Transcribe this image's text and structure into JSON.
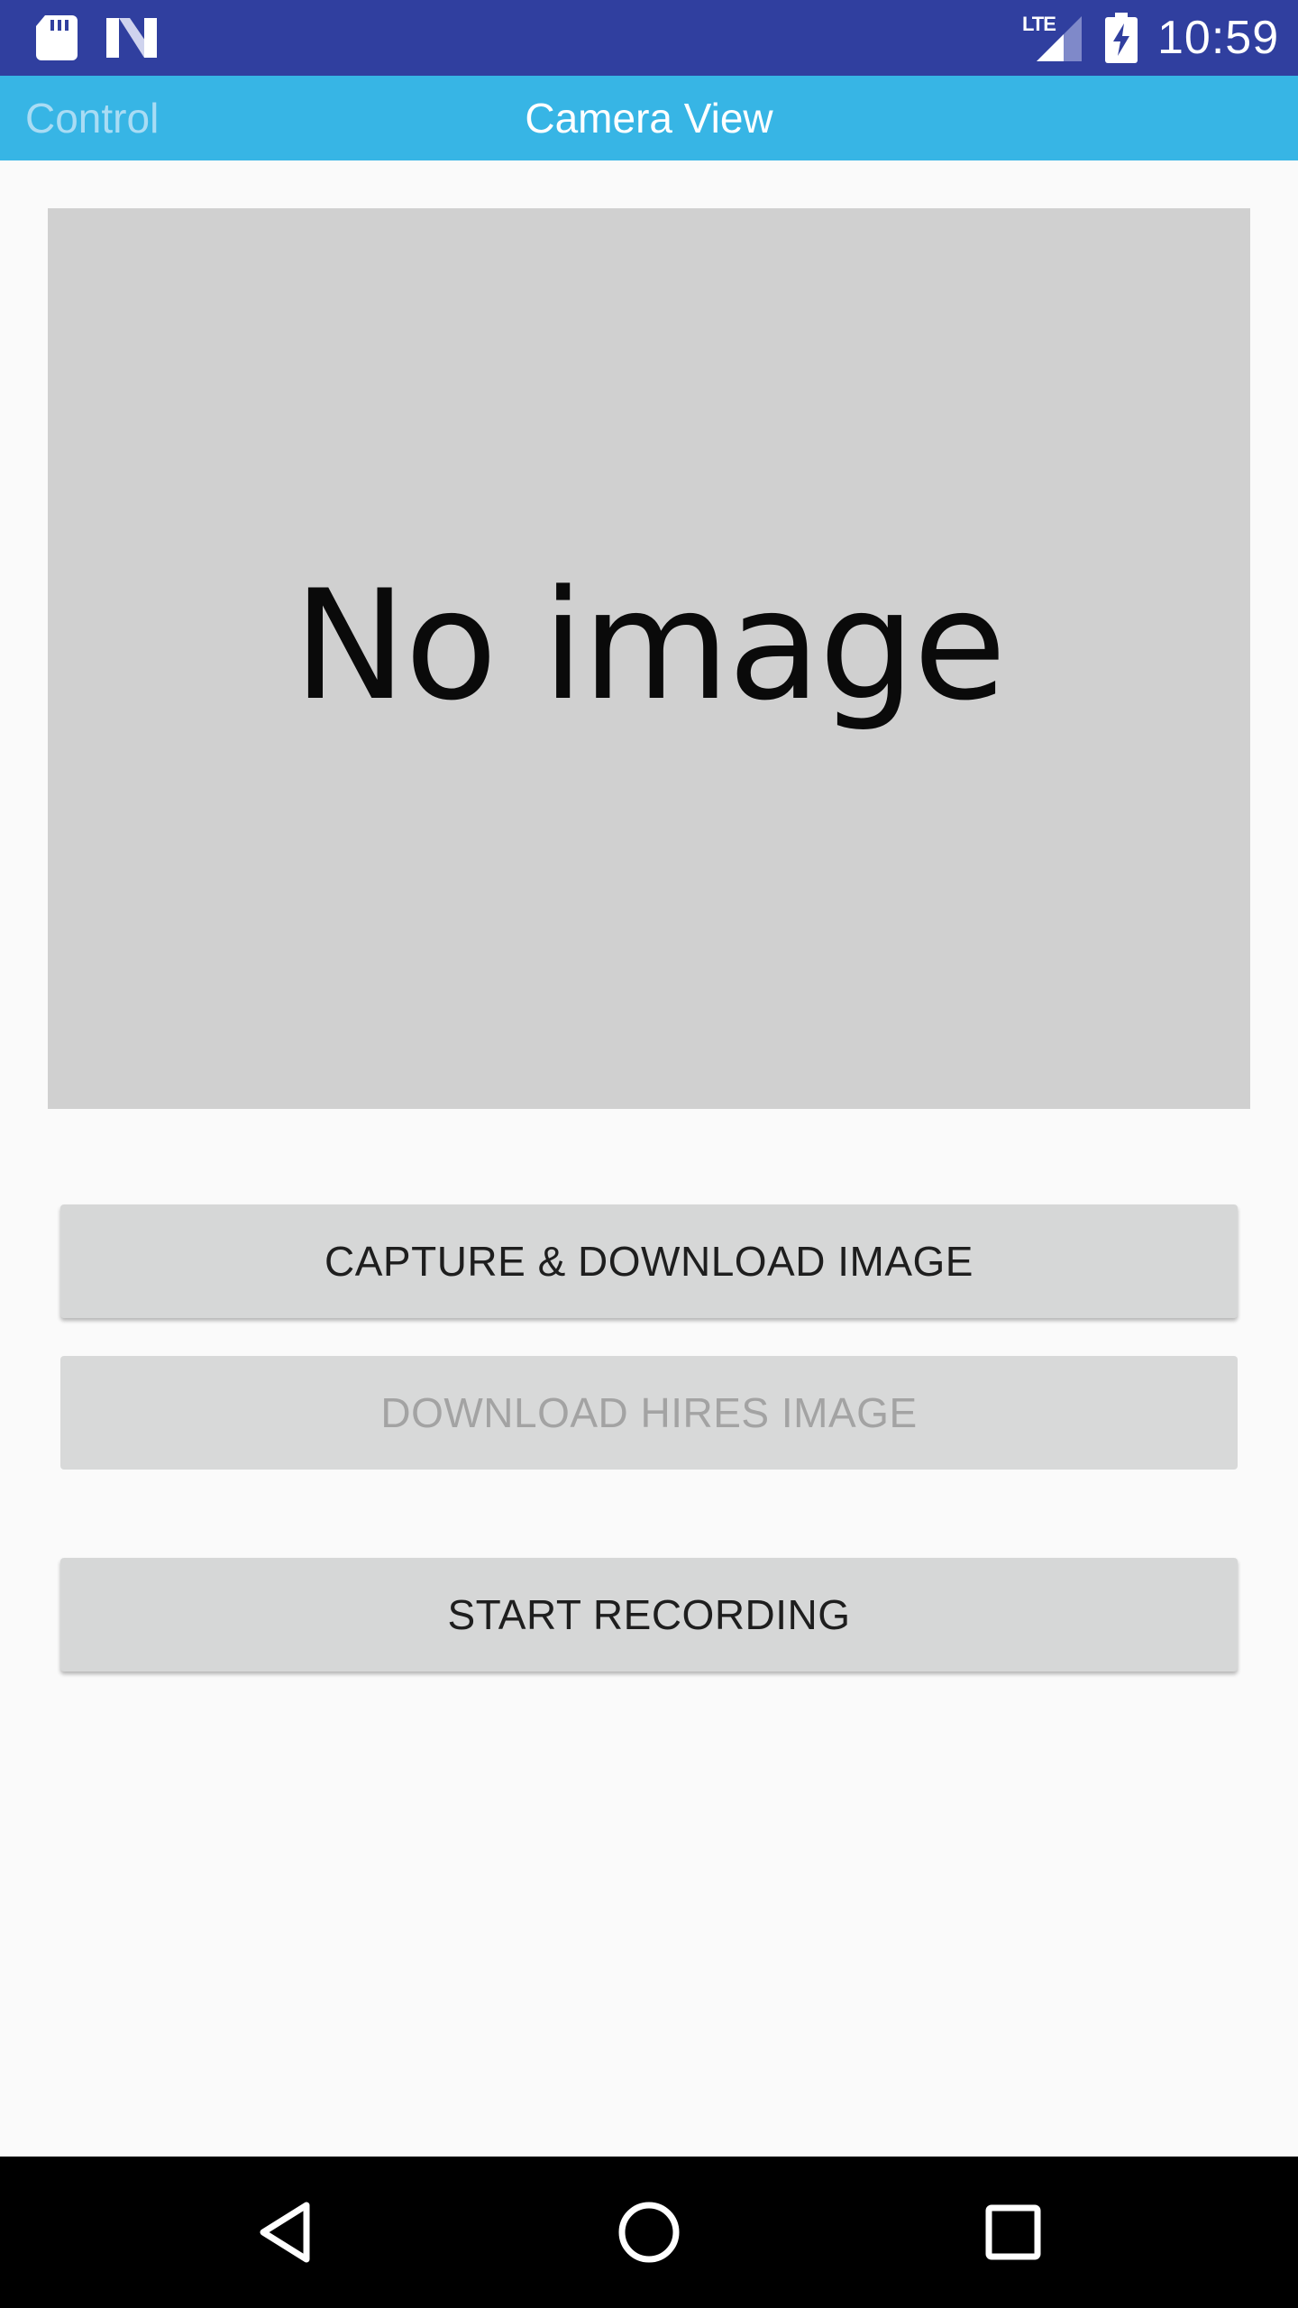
{
  "status_bar": {
    "time": "10:59",
    "network_label": "LTE",
    "icons": [
      "sd-card-icon",
      "n-notification-icon",
      "lte-signal-icon",
      "battery-charging-icon"
    ]
  },
  "action_bar": {
    "back_label": "Control",
    "title": "Camera View",
    "color": "#37b5e5"
  },
  "image_view": {
    "placeholder_text": "No image"
  },
  "buttons": {
    "capture": "CAPTURE & DOWNLOAD IMAGE",
    "hires": "DOWNLOAD HIRES IMAGE",
    "record": "START RECORDING"
  },
  "nav_bar": {
    "icons": [
      "back-triangle-icon",
      "home-circle-icon",
      "recents-square-icon"
    ]
  },
  "colors": {
    "status_bar": "#303f9f",
    "action_bar": "#37b5e5",
    "button": "#d6d7d7",
    "disabled_text": "#a3a3a3"
  }
}
